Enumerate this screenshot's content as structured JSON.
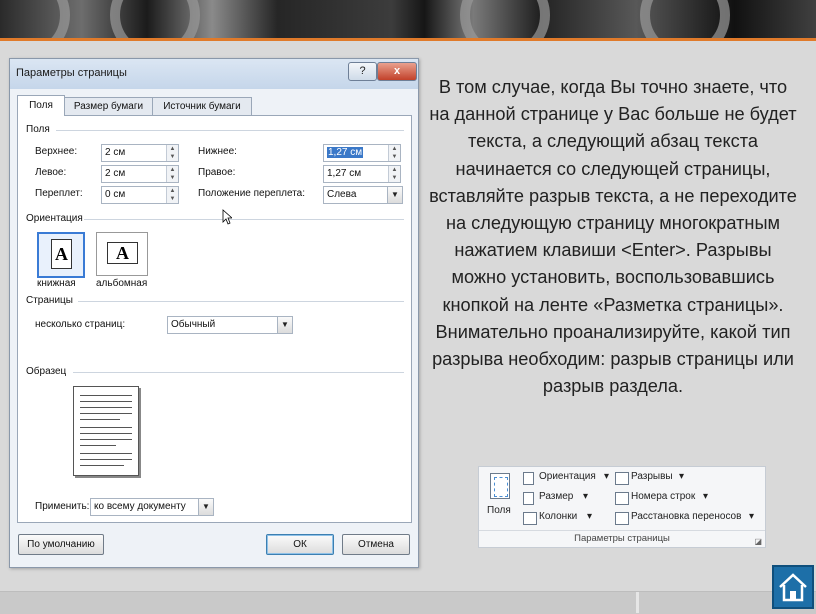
{
  "dialog": {
    "title": "Параметры страницы",
    "help_button": "?",
    "close_button": "x",
    "tabs": [
      "Поля",
      "Размер бумаги",
      "Источник бумаги"
    ],
    "margins": {
      "section": "Поля",
      "top_label": "Верхнее:",
      "top_value": "2 см",
      "bottom_label": "Нижнее:",
      "bottom_value": "1,27 см",
      "left_label": "Левое:",
      "left_value": "2 см",
      "right_label": "Правое:",
      "right_value": "1,27 см",
      "gutter_label": "Переплет:",
      "gutter_value": "0 см",
      "gutter_pos_label": "Положение переплета:",
      "gutter_pos_value": "Слева"
    },
    "orientation": {
      "section": "Ориентация",
      "portrait_glyph": "A",
      "portrait_label": "книжная",
      "landscape_glyph": "A",
      "landscape_label": "альбомная",
      "selected": "portrait"
    },
    "pages": {
      "section": "Страницы",
      "multiple_label": "несколько страниц:",
      "multiple_value": "Обычный"
    },
    "preview": {
      "section": "Образец"
    },
    "apply": {
      "label": "Применить:",
      "value": "ко всему документу"
    },
    "buttons": {
      "default": "По умолчанию",
      "ok": "ОК",
      "cancel": "Отмена"
    }
  },
  "paragraph": "В том случае, когда Вы точно знаете, что на данной странице у Вас больше не будет текста, а следующий абзац текста начинается со следующей страницы, вставляйте разрыв текста, а не переходите на следующую страницу многократным нажатием клавиши <Enter>. Разрывы можно установить, воспользовавшись кнопкой на ленте «Разметка страницы». Внимательно проанализируйте, какой тип разрыва необходим: разрыв страницы или разрыв раздела.",
  "ribbon": {
    "margins": "Поля",
    "orientation": "Ориентация",
    "size": "Размер",
    "columns": "Колонки",
    "breaks": "Разрывы",
    "line_numbers": "Номера строк",
    "hyphenation": "Расстановка переносов",
    "group_label": "Параметры страницы",
    "dropdown": "▾"
  },
  "colors": {
    "accent": "#e07a2a",
    "selection": "#3a78c8",
    "home_button": "#1d6fa8"
  },
  "icons": {
    "home": "home-icon",
    "cursor": "mouse-cursor-icon",
    "orientation": "orientation-icon",
    "size": "size-icon",
    "columns": "columns-icon",
    "breaks": "breaks-icon",
    "line_numbers": "line-numbers-icon",
    "hyphenation": "hyphenation-icon"
  }
}
